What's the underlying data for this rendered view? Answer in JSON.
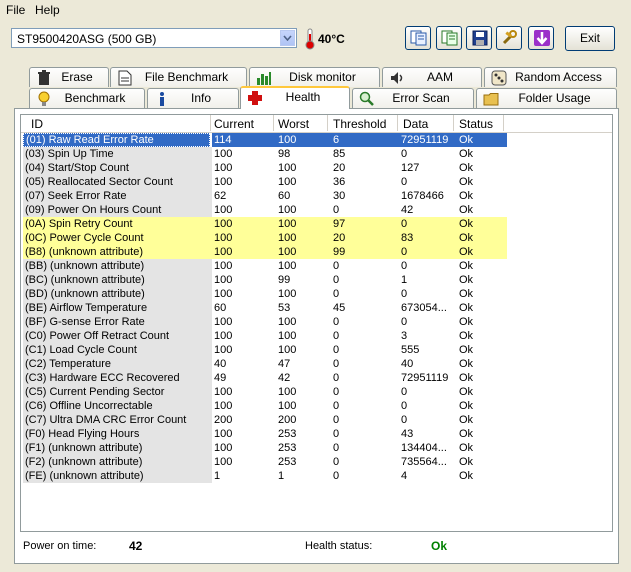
{
  "menu": {
    "file": "File",
    "help": "Help"
  },
  "toolbar": {
    "drive": "ST9500420ASG (500 GB)",
    "temperature": "40°C",
    "exit_label": "Exit"
  },
  "tabs_top": [
    "Erase",
    "File Benchmark",
    "Disk monitor",
    "AAM",
    "Random Access"
  ],
  "tabs_bottom": [
    "Benchmark",
    "Info",
    "Health",
    "Error Scan",
    "Folder Usage"
  ],
  "active_tab": "Health",
  "table": {
    "columns": [
      "ID",
      "Current",
      "Worst",
      "Threshold",
      "Data",
      "Status"
    ],
    "rows": [
      [
        "(01) Raw Read Error Rate",
        "114",
        "100",
        "6",
        "72951119",
        "Ok"
      ],
      [
        "(03) Spin Up Time",
        "100",
        "98",
        "85",
        "0",
        "Ok"
      ],
      [
        "(04) Start/Stop Count",
        "100",
        "100",
        "20",
        "127",
        "Ok"
      ],
      [
        "(05) Reallocated Sector Count",
        "100",
        "100",
        "36",
        "0",
        "Ok"
      ],
      [
        "(07) Seek Error Rate",
        "62",
        "60",
        "30",
        "1678466",
        "Ok"
      ],
      [
        "(09) Power On Hours Count",
        "100",
        "100",
        "0",
        "42",
        "Ok"
      ],
      [
        "(0A) Spin Retry Count",
        "100",
        "100",
        "97",
        "0",
        "Ok"
      ],
      [
        "(0C) Power Cycle Count",
        "100",
        "100",
        "20",
        "83",
        "Ok"
      ],
      [
        "(B8) (unknown attribute)",
        "100",
        "100",
        "99",
        "0",
        "Ok"
      ],
      [
        "(BB) (unknown attribute)",
        "100",
        "100",
        "0",
        "0",
        "Ok"
      ],
      [
        "(BC) (unknown attribute)",
        "100",
        "99",
        "0",
        "1",
        "Ok"
      ],
      [
        "(BD) (unknown attribute)",
        "100",
        "100",
        "0",
        "0",
        "Ok"
      ],
      [
        "(BE) Airflow Temperature",
        "60",
        "53",
        "45",
        "673054...",
        "Ok"
      ],
      [
        "(BF) G-sense Error Rate",
        "100",
        "100",
        "0",
        "0",
        "Ok"
      ],
      [
        "(C0) Power Off Retract Count",
        "100",
        "100",
        "0",
        "3",
        "Ok"
      ],
      [
        "(C1) Load Cycle Count",
        "100",
        "100",
        "0",
        "555",
        "Ok"
      ],
      [
        "(C2) Temperature",
        "40",
        "47",
        "0",
        "40",
        "Ok"
      ],
      [
        "(C3) Hardware ECC Recovered",
        "49",
        "42",
        "0",
        "72951119",
        "Ok"
      ],
      [
        "(C5) Current Pending Sector",
        "100",
        "100",
        "0",
        "0",
        "Ok"
      ],
      [
        "(C6) Offline Uncorrectable",
        "100",
        "100",
        "0",
        "0",
        "Ok"
      ],
      [
        "(C7) Ultra DMA CRC Error Count",
        "200",
        "200",
        "0",
        "0",
        "Ok"
      ],
      [
        "(F0) Head Flying Hours",
        "100",
        "253",
        "0",
        "43",
        "Ok"
      ],
      [
        "(F1) (unknown attribute)",
        "100",
        "253",
        "0",
        "134404...",
        "Ok"
      ],
      [
        "(F2) (unknown attribute)",
        "100",
        "253",
        "0",
        "735564...",
        "Ok"
      ],
      [
        "(FE) (unknown attribute)",
        "1",
        "1",
        "0",
        "4",
        "Ok"
      ]
    ],
    "selected_row": 0,
    "highlighted_rows": [
      6,
      7,
      8
    ],
    "highlight_color": "#ffff99",
    "selection_color": "#316ac5"
  },
  "footer": {
    "power_on_label": "Power on time:",
    "power_on_value": "42",
    "health_label": "Health status:",
    "health_value": "Ok",
    "health_color": "#008000"
  }
}
